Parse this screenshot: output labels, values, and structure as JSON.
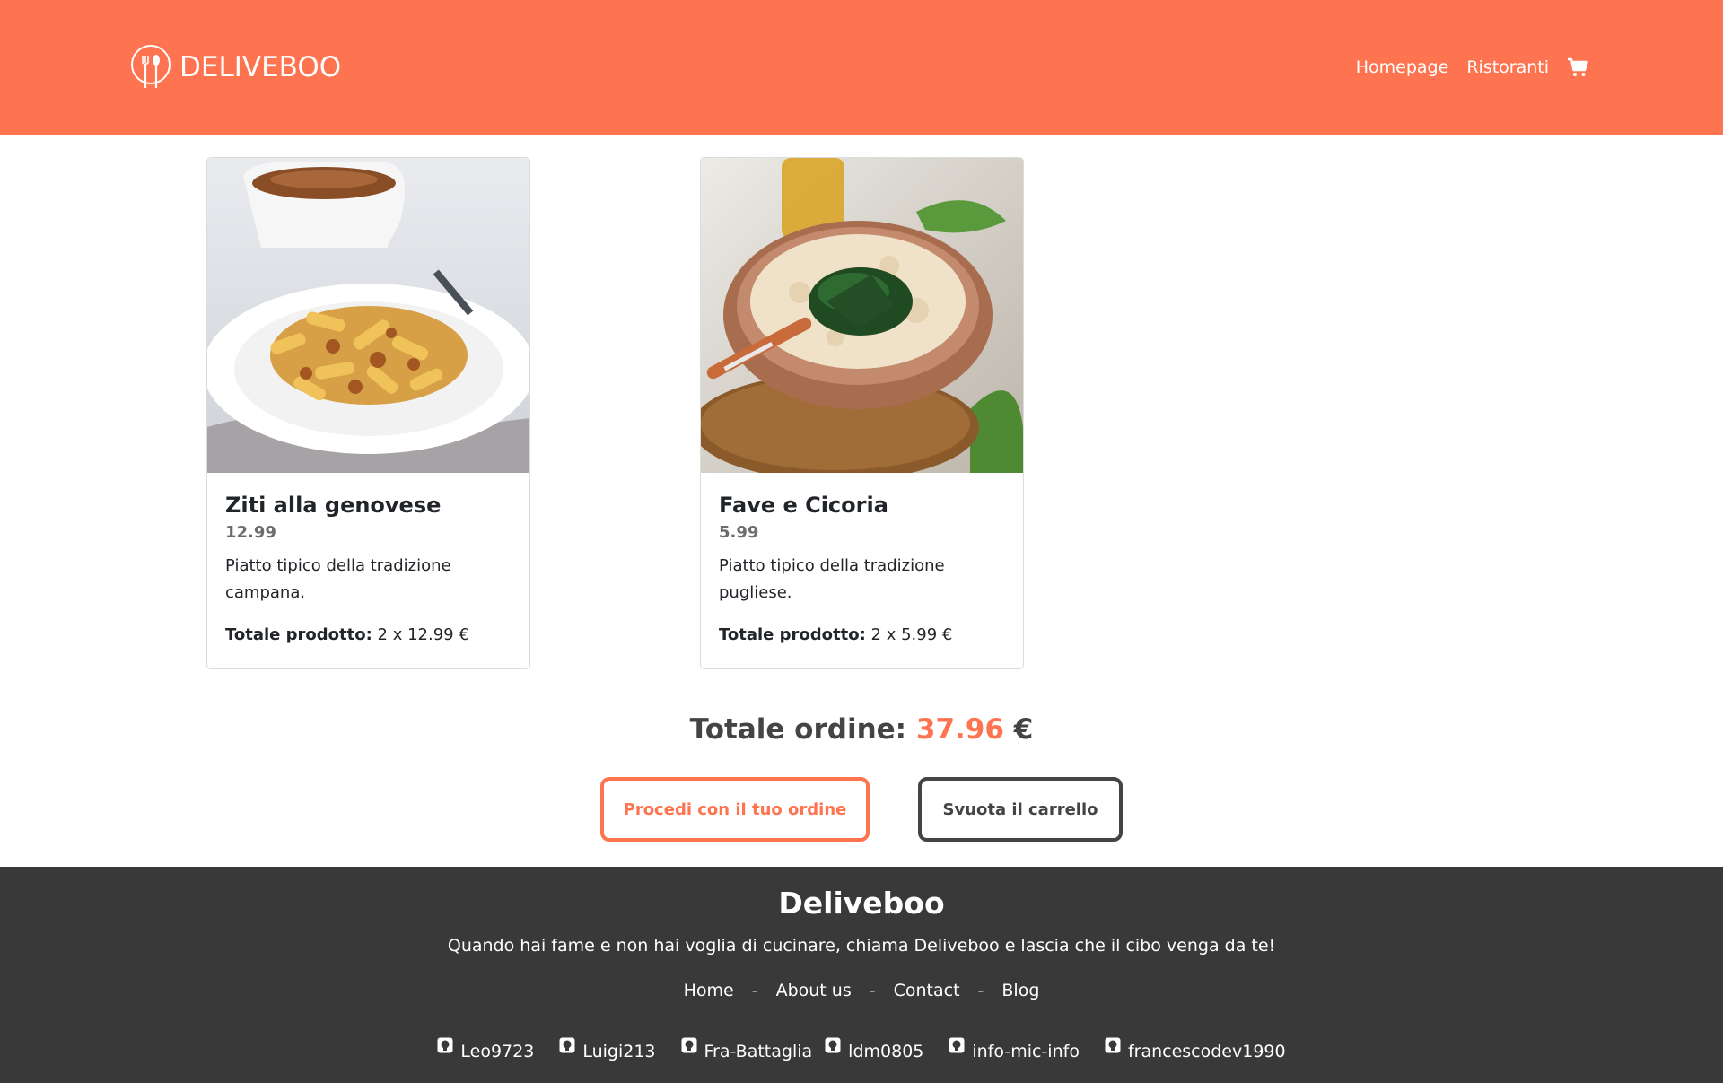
{
  "header": {
    "brand": "DELIVEBOO",
    "nav": {
      "homepage": "Homepage",
      "restaurants": "Ristoranti"
    },
    "icons": [
      "fork-spoon-logo-icon",
      "shopping-cart-icon"
    ],
    "background_color": "#ff7450"
  },
  "cart": {
    "items": [
      {
        "name": "Ziti alla genovese",
        "price": "12.99",
        "description": "Piatto tipico della tradizione campana.",
        "total_label": "Totale prodotto:",
        "total_value": "2 x 12.99 €"
      },
      {
        "name": "Fave e Cicoria",
        "price": "5.99",
        "description": "Piatto tipico della tradizione pugliese.",
        "total_label": "Totale prodotto:",
        "total_value": "2 x 5.99 €"
      }
    ],
    "order_total_label": "Totale ordine:",
    "order_total_amount": "37.96",
    "order_total_currency": "€",
    "proceed_button": "Procedi con il tuo ordine",
    "empty_button": "Svuota il carrello",
    "accent_color": "#ff7450",
    "secondary_color": "#444444"
  },
  "footer": {
    "title": "Deliveboo",
    "tagline": "Quando hai fame e non hai voglia di cucinare, chiama Deliveboo e lascia che il cibo venga da te!",
    "links": [
      "Home",
      "About us",
      "Contact",
      "Blog"
    ],
    "separator": "-",
    "developers": [
      "Leo9723",
      "Luigi213",
      "Fra-Battaglia",
      "ldm0805",
      "info-mic-info",
      "francescodev1990"
    ],
    "developer_icon": "github-icon",
    "background_color": "#393939"
  }
}
